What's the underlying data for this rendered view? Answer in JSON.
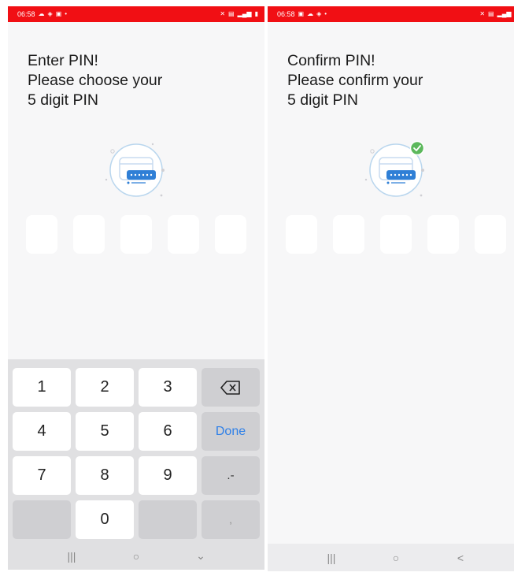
{
  "left_screen": {
    "status_time": "06:58",
    "heading_line1": "Enter PIN!",
    "heading_line2": "Please choose your",
    "heading_line3": "5 digit PIN",
    "keys": {
      "k1": "1",
      "k2": "2",
      "k3": "3",
      "k4": "4",
      "k5": "5",
      "k6": "6",
      "done": "Done",
      "k7": "7",
      "k8": "8",
      "k9": "9",
      "sym": ".-",
      "k0": "0",
      "comma": ","
    }
  },
  "right_screen": {
    "status_time": "06:58",
    "heading_line1": "Confirm PIN!",
    "heading_line2": "Please confirm your",
    "heading_line3": "5 digit PIN"
  },
  "nav": {
    "recents_glyph": "|||",
    "home_glyph": "○",
    "left_down_glyph": "⌄",
    "right_back_glyph": "<"
  },
  "colors": {
    "status_bar": "#f10f14",
    "accent_blue": "#2f80e8",
    "check_green": "#5cb85c"
  }
}
